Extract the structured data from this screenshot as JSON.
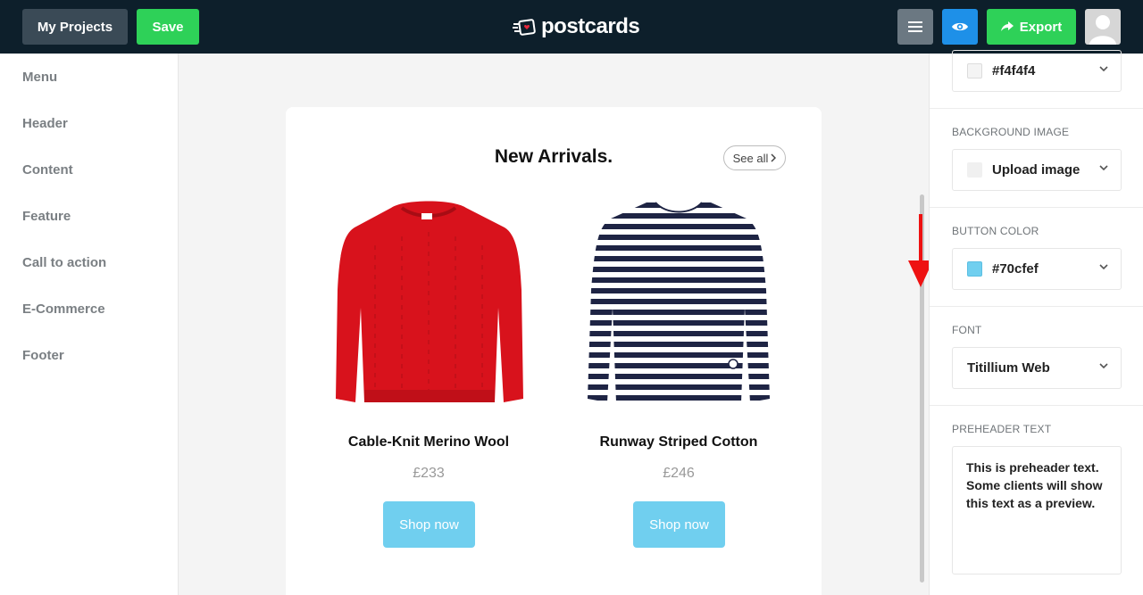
{
  "topbar": {
    "my_projects_label": "My Projects",
    "save_label": "Save",
    "logo_text": "postcards",
    "export_label": "Export"
  },
  "sidebar": {
    "items": [
      {
        "label": "Menu"
      },
      {
        "label": "Header"
      },
      {
        "label": "Content"
      },
      {
        "label": "Feature"
      },
      {
        "label": "Call to action"
      },
      {
        "label": "E-Commerce"
      },
      {
        "label": "Footer"
      }
    ]
  },
  "canvas": {
    "title": "New Arrivals.",
    "see_all_label": "See all",
    "products": [
      {
        "name": "Cable-Knit Merino Wool",
        "price": "£233",
        "button_label": "Shop now",
        "color": "#d8121c"
      },
      {
        "name": "Runway Striped Cotton",
        "price": "£246",
        "button_label": "Shop now",
        "color": "#1e2444"
      }
    ]
  },
  "right_panel": {
    "background_color_value": "#f4f4f4",
    "background_image_label": "BACKGROUND IMAGE",
    "background_image_value": "Upload image",
    "button_color_label": "BUTTON COLOR",
    "button_color_value": "#70cfef",
    "font_label": "FONT",
    "font_value": "Titillium Web",
    "preheader_label": "PREHEADER TEXT",
    "preheader_value": "This is preheader text. Some clients will show this text as a preview."
  },
  "colors": {
    "accent_green": "#2ed158",
    "accent_blue": "#1e90e8",
    "topbar_bg": "#0d1f2b",
    "button_color": "#70cfef"
  }
}
